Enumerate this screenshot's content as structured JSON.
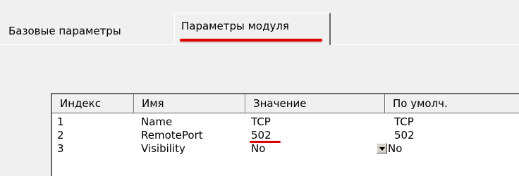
{
  "tabs": {
    "inactive_label": "Базовые параметры",
    "active_label": "Параметры модуля"
  },
  "grid": {
    "headers": [
      "Индекс",
      "Имя",
      "Значение",
      "По умолч."
    ],
    "rows": [
      {
        "index": "1",
        "name": "Name",
        "value": "TCP",
        "default": "TCP"
      },
      {
        "index": "2",
        "name": "RemotePort",
        "value": "502",
        "default": "502"
      },
      {
        "index": "3",
        "name": "Visibility",
        "value": "No",
        "default": "No"
      }
    ]
  },
  "colors": {
    "highlight": "#e00000",
    "background": "#f0f0f0",
    "grid_background": "#ffffff"
  },
  "icons": {
    "dropdown": "chevron-down-icon"
  }
}
